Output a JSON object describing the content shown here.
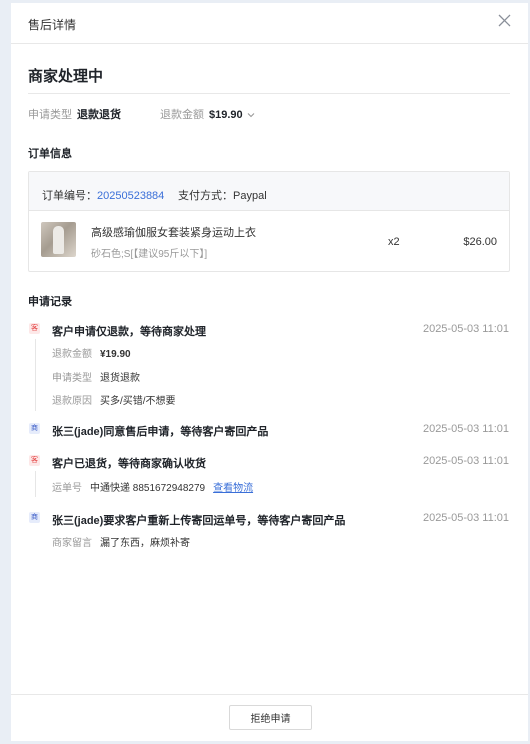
{
  "dialog": {
    "title": "售后详情"
  },
  "status": "商家处理中",
  "meta": {
    "type_label": "申请类型",
    "type_value": "退款退货",
    "amount_label": "退款金额",
    "amount_value": "$19.90"
  },
  "order_section": {
    "title": "订单信息",
    "order_no_label": "订单编号：",
    "order_no": "20250523884",
    "payment_label": "支付方式：",
    "payment": "Paypal",
    "product": {
      "name": "高级感瑜伽服女套装紧身运动上衣",
      "sku": "砂石色;S[【建议95斤以下】]",
      "qty": "x2",
      "price": "$26.00"
    }
  },
  "records_section": {
    "title": "申请记录",
    "records": [
      {
        "badge": "客",
        "title": "客户申请仅退款，等待商家处理",
        "time": "2025-05-03 11:01",
        "details": [
          {
            "k": "退款金额",
            "v": "¥19.90"
          },
          {
            "k": "申请类型",
            "v": "退货退款"
          },
          {
            "k": "退款原因",
            "v": "买多/买错/不想要"
          }
        ]
      },
      {
        "badge": "商",
        "title": "张三(jade)同意售后申请，等待客户寄回产品",
        "time": "2025-05-03 11:01"
      },
      {
        "badge": "客",
        "title": "客户已退货，等待商家确认收货",
        "time": "2025-05-03 11:01",
        "details": [
          {
            "k": "运单号",
            "v": "中通快递 8851672948279",
            "link": "查看物流"
          }
        ]
      },
      {
        "badge": "商",
        "title": "张三(jade)要求客户重新上传寄回运单号，等待客户寄回产品",
        "time": "2025-05-03 11:01",
        "details": [
          {
            "k": "商家留言",
            "v": "漏了东西，麻烦补寄"
          }
        ]
      }
    ]
  },
  "footer": {
    "reject_label": "拒绝申请"
  },
  "colors": {
    "link": "#3a6fd8",
    "customer_badge": "#e23d3d",
    "merchant_badge": "#3a5bc7"
  },
  "icons": {
    "close": "close-icon",
    "dropdown": "chevron-down-icon"
  }
}
